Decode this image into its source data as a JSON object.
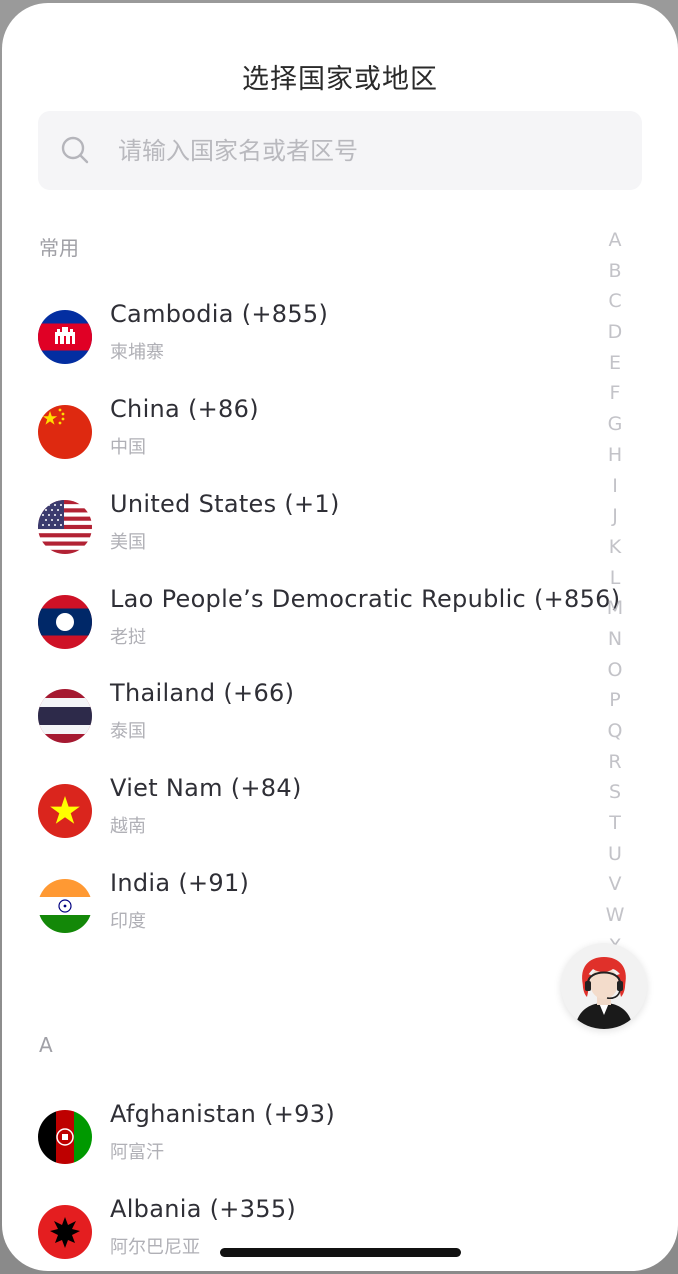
{
  "header": {
    "title": "选择国家或地区"
  },
  "search": {
    "placeholder": "请输入国家名或者区号",
    "icon": "search-icon"
  },
  "sections": [
    {
      "header": "常用",
      "items": [
        {
          "name": "Cambodia (+855)",
          "local": "柬埔寨",
          "flag": "cambodia"
        },
        {
          "name": "China (+86)",
          "local": "中国",
          "flag": "china"
        },
        {
          "name": "United States (+1)",
          "local": "美国",
          "flag": "united-states"
        },
        {
          "name": "Lao People’s Democratic Republic (+856)",
          "local": "老挝",
          "flag": "laos"
        },
        {
          "name": "Thailand (+66)",
          "local": "泰国",
          "flag": "thailand"
        },
        {
          "name": "Viet Nam (+84)",
          "local": "越南",
          "flag": "vietnam"
        },
        {
          "name": "India (+91)",
          "local": "印度",
          "flag": "india"
        }
      ]
    },
    {
      "header": "A",
      "items": [
        {
          "name": "Afghanistan (+93)",
          "local": "阿富汗",
          "flag": "afghanistan"
        },
        {
          "name": "Albania (+355)",
          "local": "阿尔巴尼亚",
          "flag": "albania"
        }
      ]
    }
  ],
  "index_letters": [
    "A",
    "B",
    "C",
    "D",
    "E",
    "F",
    "G",
    "H",
    "I",
    "J",
    "K",
    "L",
    "M",
    "N",
    "O",
    "P",
    "Q",
    "R",
    "S",
    "T",
    "U",
    "V",
    "W",
    "X"
  ],
  "support": {
    "icon": "customer-service-agent-icon"
  },
  "colors": {
    "background": "#ffffff",
    "text": "#2f2f36",
    "secondary": "#b0b0b6",
    "index": "#c3c3c8",
    "search_bg": "#f5f5f7"
  }
}
